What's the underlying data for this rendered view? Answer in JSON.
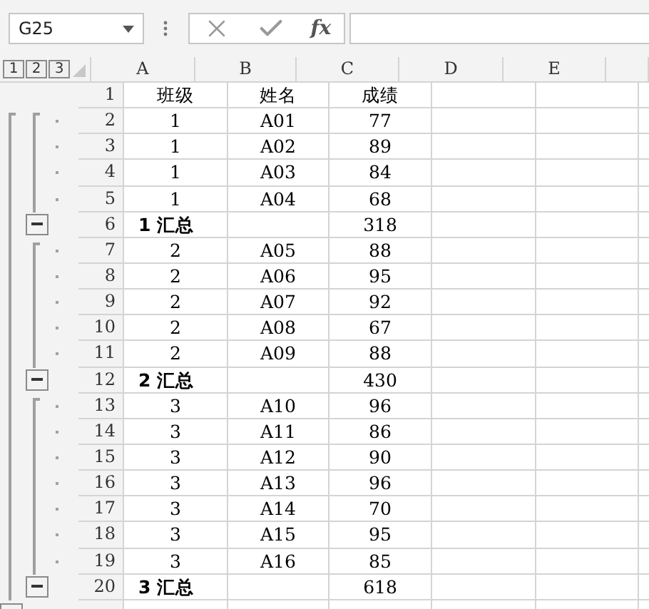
{
  "name_box": {
    "value": "G25"
  },
  "formula_bar": {
    "function_label": "fx"
  },
  "outline_levels": [
    {
      "label": "1"
    },
    {
      "label": "2"
    },
    {
      "label": "3"
    }
  ],
  "columns": [
    "A",
    "B",
    "C",
    "D",
    "E"
  ],
  "rows": [
    {
      "number": "1",
      "kind": "header",
      "a": "班级",
      "b": "姓名",
      "c": "成绩"
    },
    {
      "number": "2",
      "kind": "detail",
      "a": "1",
      "b": "A01",
      "c": "77"
    },
    {
      "number": "3",
      "kind": "detail",
      "a": "1",
      "b": "A02",
      "c": "89"
    },
    {
      "number": "4",
      "kind": "detail",
      "a": "1",
      "b": "A03",
      "c": "84"
    },
    {
      "number": "5",
      "kind": "detail",
      "a": "1",
      "b": "A04",
      "c": "68"
    },
    {
      "number": "6",
      "kind": "subtotal",
      "expanded": true,
      "a": "1 汇总",
      "c": "318"
    },
    {
      "number": "7",
      "kind": "detail",
      "a": "2",
      "b": "A05",
      "c": "88"
    },
    {
      "number": "8",
      "kind": "detail",
      "a": "2",
      "b": "A06",
      "c": "95"
    },
    {
      "number": "9",
      "kind": "detail",
      "a": "2",
      "b": "A07",
      "c": "92"
    },
    {
      "number": "10",
      "kind": "detail",
      "a": "2",
      "b": "A08",
      "c": "67"
    },
    {
      "number": "11",
      "kind": "detail",
      "a": "2",
      "b": "A09",
      "c": "88"
    },
    {
      "number": "12",
      "kind": "subtotal",
      "expanded": true,
      "a": "2 汇总",
      "c": "430"
    },
    {
      "number": "13",
      "kind": "detail",
      "a": "3",
      "b": "A10",
      "c": "96"
    },
    {
      "number": "14",
      "kind": "detail",
      "a": "3",
      "b": "A11",
      "c": "86"
    },
    {
      "number": "15",
      "kind": "detail",
      "a": "3",
      "b": "A12",
      "c": "90"
    },
    {
      "number": "16",
      "kind": "detail",
      "a": "3",
      "b": "A13",
      "c": "96"
    },
    {
      "number": "17",
      "kind": "detail",
      "a": "3",
      "b": "A14",
      "c": "70"
    },
    {
      "number": "18",
      "kind": "detail",
      "a": "3",
      "b": "A15",
      "c": "95"
    },
    {
      "number": "19",
      "kind": "detail",
      "a": "3",
      "b": "A16",
      "c": "85"
    },
    {
      "number": "20",
      "kind": "subtotal",
      "expanded": true,
      "a": "3 汇总",
      "c": "618"
    },
    {
      "kind": "total"
    }
  ]
}
